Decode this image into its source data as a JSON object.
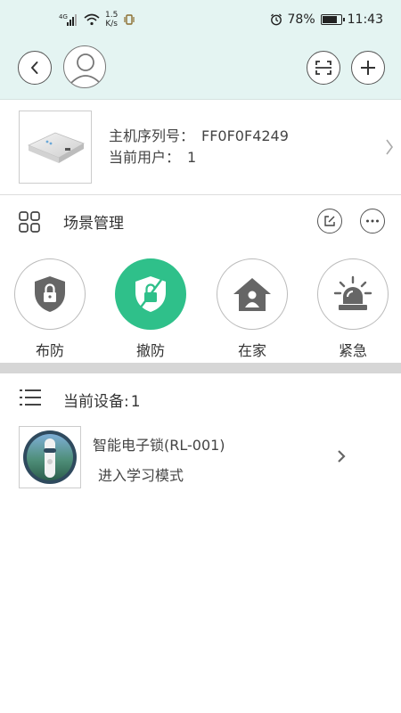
{
  "status_bar": {
    "network": "4G",
    "net_speed_value": "1.5",
    "net_speed_unit": "K/s",
    "battery": "78%",
    "battery_level": 0.78,
    "time": "11:43"
  },
  "nav": {
    "back_icon": "chevron-left-icon",
    "avatar_icon": "user-avatar-icon",
    "scan_icon": "scan-icon",
    "add_icon": "plus-icon"
  },
  "host": {
    "serial_label": "主机序列号：",
    "serial_value": "FF0F0F4249",
    "user_label": "当前用户：",
    "user_value": "1"
  },
  "scene": {
    "title": "场景管理",
    "modes": [
      {
        "label": "布防",
        "icon": "shield-lock-icon",
        "active": false
      },
      {
        "label": "撤防",
        "icon": "shield-unlock-icon",
        "active": true
      },
      {
        "label": "在家",
        "icon": "home-person-icon",
        "active": false
      },
      {
        "label": "紧急",
        "icon": "alarm-light-icon",
        "active": false
      }
    ]
  },
  "devices": {
    "title_label": "当前设备:",
    "count": "1",
    "items": [
      {
        "name": "智能电子锁(RL-001)",
        "status": "进入学习模式",
        "icon": "smart-lock-icon"
      }
    ]
  },
  "colors": {
    "header_bg": "#e4f4f2",
    "accent_green": "#2fc08a",
    "icon_gray": "#666666"
  }
}
